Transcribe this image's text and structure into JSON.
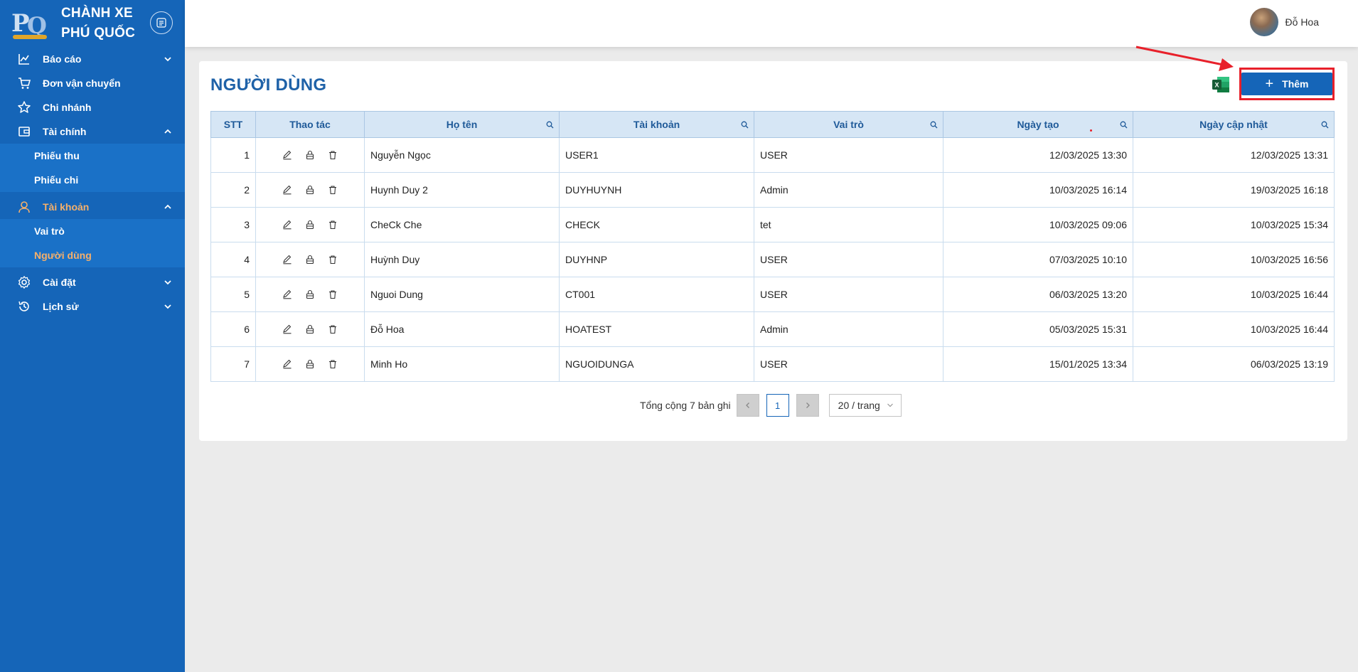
{
  "brand": {
    "line1": "CHÀNH XE",
    "line2": "PHÚ QUỐC",
    "logo_text_p": "P",
    "logo_text_q": "Q"
  },
  "sidebar": {
    "items": [
      {
        "label": "Báo cáo",
        "icon": "chart-line-icon",
        "expanded": false
      },
      {
        "label": "Đơn vận chuyển",
        "icon": "cart-icon"
      },
      {
        "label": "Chi nhánh",
        "icon": "star-icon"
      },
      {
        "label": "Tài chính",
        "icon": "wallet-icon",
        "expanded": true,
        "children": [
          {
            "label": "Phiếu thu"
          },
          {
            "label": "Phiếu chi"
          }
        ]
      },
      {
        "label": "Tài khoản",
        "icon": "user-icon",
        "expanded": true,
        "active": true,
        "children": [
          {
            "label": "Vai trò"
          },
          {
            "label": "Người dùng",
            "active": true
          }
        ]
      },
      {
        "label": "Cài đặt",
        "icon": "gear-icon",
        "expanded": false
      },
      {
        "label": "Lịch sử",
        "icon": "history-icon",
        "expanded": false
      }
    ]
  },
  "header": {
    "user_name": "Đỗ Hoa"
  },
  "page": {
    "title": "NGƯỜI DÙNG",
    "add_label": "Thêm"
  },
  "table": {
    "columns": [
      "STT",
      "Thao tác",
      "Họ tên",
      "Tài khoản",
      "Vai trò",
      "Ngày tạo",
      "Ngày cập nhật"
    ],
    "rows": [
      {
        "stt": "1",
        "name": "Nguyễn Ngọc",
        "account": "USER1",
        "role": "USER",
        "created": "12/03/2025 13:30",
        "updated": "12/03/2025 13:31"
      },
      {
        "stt": "2",
        "name": "Huynh Duy 2",
        "account": "DUYHUYNH",
        "role": "Admin",
        "created": "10/03/2025 16:14",
        "updated": "19/03/2025 16:18"
      },
      {
        "stt": "3",
        "name": "CheCk Che",
        "account": "CHECK",
        "role": "tet",
        "created": "10/03/2025 09:06",
        "updated": "10/03/2025 15:34"
      },
      {
        "stt": "4",
        "name": "Huỳnh Duy",
        "account": "DUYHNP",
        "role": "USER",
        "created": "07/03/2025 10:10",
        "updated": "10/03/2025 16:56"
      },
      {
        "stt": "5",
        "name": "Nguoi Dung",
        "account": "CT001",
        "role": "USER",
        "created": "06/03/2025 13:20",
        "updated": "10/03/2025 16:44"
      },
      {
        "stt": "6",
        "name": "Đỗ Hoa",
        "account": "HOATEST",
        "role": "Admin",
        "created": "05/03/2025 15:31",
        "updated": "10/03/2025 16:44"
      },
      {
        "stt": "7",
        "name": "Minh Ho",
        "account": "NGUOIDUNGA",
        "role": "USER",
        "created": "15/01/2025 13:34",
        "updated": "06/03/2025 13:19"
      }
    ]
  },
  "pagination": {
    "total_text": "Tổng cộng 7 bản ghi",
    "current_page": "1",
    "page_size": "20 / trang",
    "prev": "<",
    "next": ">"
  },
  "colors": {
    "primary": "#1565b8",
    "active_menu": "#f6b06a",
    "header_bg": "#d6e6f5",
    "highlight": "#e8202a"
  }
}
